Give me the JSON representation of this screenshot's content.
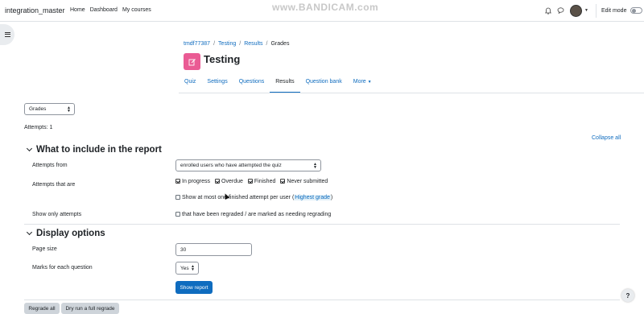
{
  "watermark": "www.BANDICAM.com",
  "header": {
    "site_name": "integration_master",
    "nav": [
      "Home",
      "Dashboard",
      "My courses"
    ],
    "edit_mode": "Edit mode"
  },
  "breadcrumb": [
    "tmdf77387",
    "Testing",
    "Results",
    "Grades"
  ],
  "page_title": "Testing",
  "tabs": [
    "Quiz",
    "Settings",
    "Questions",
    "Results",
    "Question bank",
    "More"
  ],
  "active_tab": "Results",
  "report_select": "Grades",
  "attempts_text": "Attempts: 1",
  "collapse_all": "Collapse all",
  "section_include": {
    "title": "What to include in the report",
    "attempts_from_label": "Attempts from",
    "attempts_from_value": "enrolled users who have attempted the quiz",
    "attempts_that_are_label": "Attempts that are",
    "states": [
      {
        "label": "In progress",
        "checked": true
      },
      {
        "label": "Overdue",
        "checked": true
      },
      {
        "label": "Finished",
        "checked": true
      },
      {
        "label": "Never submitted",
        "checked": true
      }
    ],
    "show_at_most_prefix": "Show at most one finished attempt per user (",
    "show_at_most_highlight": "Highest grade",
    "show_at_most_suffix": ")",
    "show_only_label": "Show only attempts",
    "show_only_option": "that have been regraded / are marked as needing regrading"
  },
  "section_display": {
    "title": "Display options",
    "page_size_label": "Page size",
    "page_size_value": "30",
    "marks_label": "Marks for each question",
    "marks_value": "Yes",
    "show_report": "Show report"
  },
  "buttons": {
    "regrade_all": "Regrade all",
    "dry_run": "Dry run a full regrade"
  },
  "help": "?",
  "colors": {
    "primary": "#0f6cbf",
    "activity_icon": "#ea5b94"
  }
}
